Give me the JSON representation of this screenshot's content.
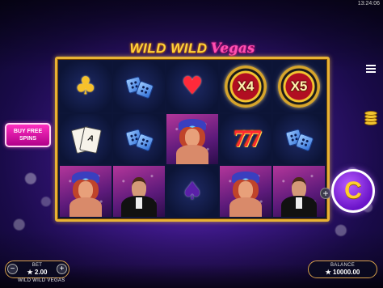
{
  "clock": "13:24:06",
  "logo": {
    "word1": "WILD WILD",
    "word2": "Vegas"
  },
  "buy_free_spins": {
    "label": "BUY FREE SPINS"
  },
  "reels": {
    "row1": [
      "♣",
      "dice",
      "♥",
      "X4",
      "X5"
    ],
    "row2": [
      "cards",
      "dice",
      "showgirl",
      "777",
      "dice"
    ],
    "row3": [
      "showgirl",
      "man",
      "♠",
      "showgirl",
      "man"
    ],
    "card_face": "A"
  },
  "bet": {
    "label": "BET",
    "value": "★ 2.00",
    "minus": "−",
    "plus": "+"
  },
  "balance": {
    "label": "BALANCE",
    "value": "★ 10000.00"
  },
  "game_name": "WILD WILD VEGAS",
  "spin": {
    "symbol": "C"
  },
  "plus_button": "+",
  "colors": {
    "frame": "#e8b234",
    "buy_button": "#ff2fbf",
    "spin_button": "#6a14c8"
  }
}
